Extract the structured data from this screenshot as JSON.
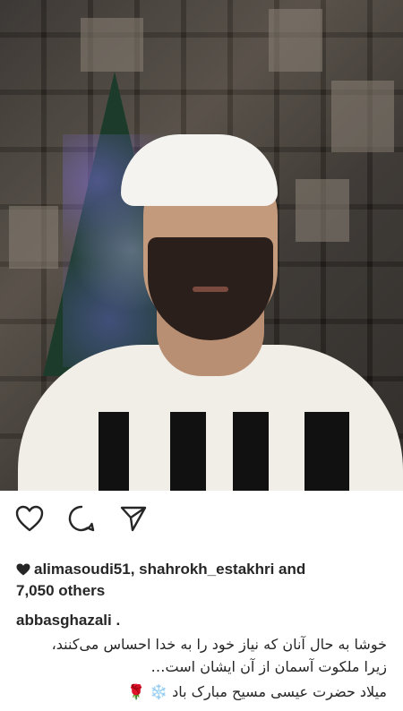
{
  "post": {
    "image_alt": "Selfie in front of Christmas tree and photo collage wall"
  },
  "actions": {
    "like_icon": "heart-outline-icon",
    "comment_icon": "comment-bubble-icon",
    "share_icon": "paper-plane-icon"
  },
  "likes": {
    "icon": "heart-filled-icon",
    "text_line1": "alimasoudi51, shahrokh_estakhri and",
    "text_line2": "7,050 others"
  },
  "caption": {
    "username": "abbasghazali .",
    "line1": "خوشا به حال آنان که نیاز خود را به خدا احساس می‌کنند،",
    "line2": "زیرا ملکوت آسمان از آن ایشان است…",
    "line3": "میلاد حضرت عیسی مسیح مبارک باد",
    "emoji_rose": "🌹",
    "emoji_snow": "❄️"
  },
  "colors": {
    "text": "#262626",
    "background": "#ffffff"
  }
}
